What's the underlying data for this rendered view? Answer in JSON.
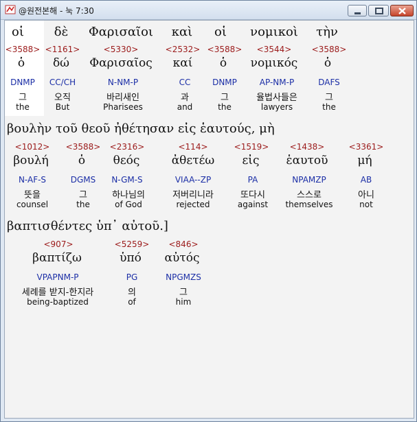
{
  "window": {
    "title": "@원전본해 - 눅 7:30",
    "icon": "bible-app-icon",
    "buttons": [
      "minimize-icon",
      "maximize-icon",
      "close-icon"
    ]
  },
  "rows": [
    {
      "words": [
        {
          "greek": "οἱ",
          "strong": "<3588>",
          "lemma": "ὁ",
          "parse": "DNMP",
          "korean": "그",
          "english": "the"
        },
        {
          "greek": "δὲ",
          "strong": "<1161>",
          "lemma": "δώ",
          "parse": "CC/CH",
          "korean": "오직",
          "english": "But"
        },
        {
          "greek": "Φαρισαῖοι",
          "strong": "<5330>",
          "lemma": "Φαρισαῖος",
          "parse": "N-NM-P",
          "korean": "바리새인",
          "english": "Pharisees"
        },
        {
          "greek": "καὶ",
          "strong": "<2532>",
          "lemma": "καί",
          "parse": "CC",
          "korean": "과",
          "english": "and"
        },
        {
          "greek": "οἱ",
          "strong": "<3588>",
          "lemma": "ὁ",
          "parse": "DNMP",
          "korean": "그",
          "english": "the"
        },
        {
          "greek": "νομικοὶ",
          "strong": "<3544>",
          "lemma": "νομικός",
          "parse": "AP-NM-P",
          "korean": "율법사들은",
          "english": "lawyers"
        },
        {
          "greek": "τὴν",
          "strong": "<3588>",
          "lemma": "ὁ",
          "parse": "DAFS",
          "korean": "그",
          "english": "the"
        }
      ]
    },
    {
      "greek_line": "βουλὴν   τοῦ   θεοῦ   ἠθέτησαν   εἰς   ἑαυτούς,   μὴ",
      "words": [
        {
          "strong": "<1012>",
          "lemma": "βουλή",
          "parse": "N-AF-S",
          "korean": "뜻을",
          "english": "counsel"
        },
        {
          "strong": "<3588>",
          "lemma": "ὁ",
          "parse": "DGMS",
          "korean": "그",
          "english": "the"
        },
        {
          "strong": "<2316>",
          "lemma": "θεός",
          "parse": "N-GM-S",
          "korean": "하나님의",
          "english": "of God"
        },
        {
          "strong": "<114>",
          "lemma": "ἀθετέω",
          "parse": "VIAA--ZP",
          "korean": "저버리니라",
          "english": "rejected"
        },
        {
          "strong": "<1519>",
          "lemma": "εἰς",
          "parse": "PA",
          "korean": "또다시",
          "english": "against"
        },
        {
          "strong": "<1438>",
          "lemma": "ἑαυτοῦ",
          "parse": "NPAMZP",
          "korean": "스스로",
          "english": "themselves"
        },
        {
          "strong": "<3361>",
          "lemma": "μή",
          "parse": "AB",
          "korean": "아니",
          "english": "not"
        }
      ]
    },
    {
      "greek_line": "βαπτισθέντες   ὑπ᾽   αὐτοῦ.]",
      "words": [
        {
          "strong": "<907>",
          "lemma": "βαπτίζω",
          "parse": "VPAPNM-P",
          "korean": "세례를 받지-한지라",
          "english": "being-baptized"
        },
        {
          "strong": "<5259>",
          "lemma": "ὑπό",
          "parse": "PG",
          "korean": "의",
          "english": "of"
        },
        {
          "strong": "<846>",
          "lemma": "αὐτός",
          "parse": "NPGMZS",
          "korean": "그",
          "english": "him"
        }
      ]
    }
  ]
}
